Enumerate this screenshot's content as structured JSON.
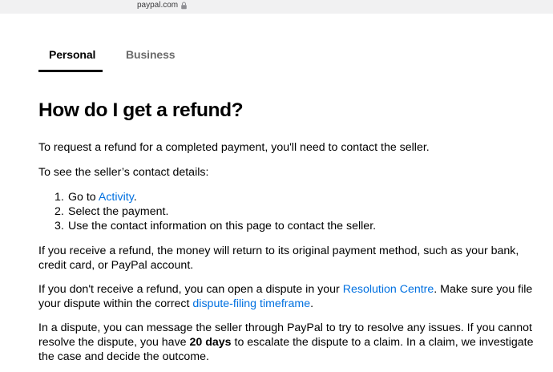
{
  "browser": {
    "url": "paypal.com"
  },
  "tabs": [
    {
      "label": "Personal",
      "active": true
    },
    {
      "label": "Business",
      "active": false
    }
  ],
  "article": {
    "title": "How do I get a refund?",
    "intro": "To request a refund for a completed payment, you'll need to contact the seller.",
    "steps_intro": "To see the seller’s contact details:",
    "steps": [
      {
        "num": "1.",
        "before": "Go to ",
        "link": "Activity",
        "after": "."
      },
      {
        "num": "2.",
        "text": "Select the payment."
      },
      {
        "num": "3.",
        "text": "Use the contact information on this page to contact the seller."
      }
    ],
    "para_refund": "If you receive a refund, the money will return to its original payment method, such as your bank, credit card, or PayPal account.",
    "para_dispute": {
      "before": "If you don't receive a refund, you can open a dispute in your ",
      "link1": "Resolution Centre",
      "middle": ". Make sure you file your dispute within the correct ",
      "link2": "dispute-filing timeframe",
      "after": "."
    },
    "para_claim": {
      "before": "In a dispute, you can message the seller through PayPal to try to resolve any issues. If you cannot resolve the dispute, you have ",
      "bold": "20 days",
      "after": " to escalate the dispute to a claim. In a claim, we investigate the case and decide the outcome."
    }
  },
  "colors": {
    "link": "#0070e0",
    "inactive_tab": "#6b6b6b",
    "urlbar": "#f1f1f2"
  },
  "icons": {
    "lock": "lock-icon"
  }
}
